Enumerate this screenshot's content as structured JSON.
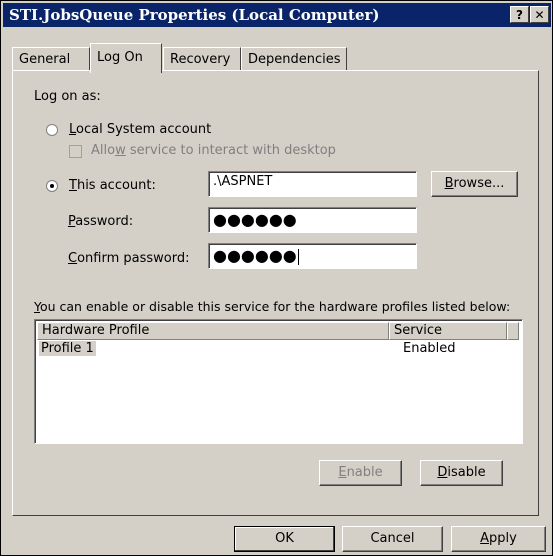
{
  "window": {
    "title": "STI.JobsQueue Properties (Local Computer)",
    "help_btn": "?",
    "close_btn": "✕"
  },
  "tabs": [
    "General",
    "Log On",
    "Recovery",
    "Dependencies"
  ],
  "logon": {
    "log_on_as": "Log on as:",
    "local_system_key": "L",
    "local_system_rest": "ocal System account",
    "allow_a": "Allo",
    "allow_key": "w",
    "allow_rest": " service to interact with desktop",
    "this_account_key": "T",
    "this_account_rest": "his account:",
    "account_value": ".\\ASPNET",
    "browse_key": "B",
    "browse_rest": "rowse...",
    "password_key": "P",
    "password_rest": "assword:",
    "password_value": "●●●●●●",
    "confirm_key": "C",
    "confirm_rest": "onfirm password:",
    "confirm_value": "●●●●●●"
  },
  "profiles": {
    "intro_key": "Y",
    "intro_rest": "ou can enable or disable this service for the hardware profiles listed below:",
    "col_profile": "Hardware Profile",
    "col_service": "Service",
    "rows": [
      {
        "profile": "Profile 1",
        "service": "Enabled"
      }
    ],
    "enable_key": "E",
    "enable_rest": "nable",
    "disable_key": "D",
    "disable_rest": "isable"
  },
  "footer": {
    "ok": "OK",
    "cancel": "Cancel",
    "apply_key": "A",
    "apply_rest": "pply"
  }
}
